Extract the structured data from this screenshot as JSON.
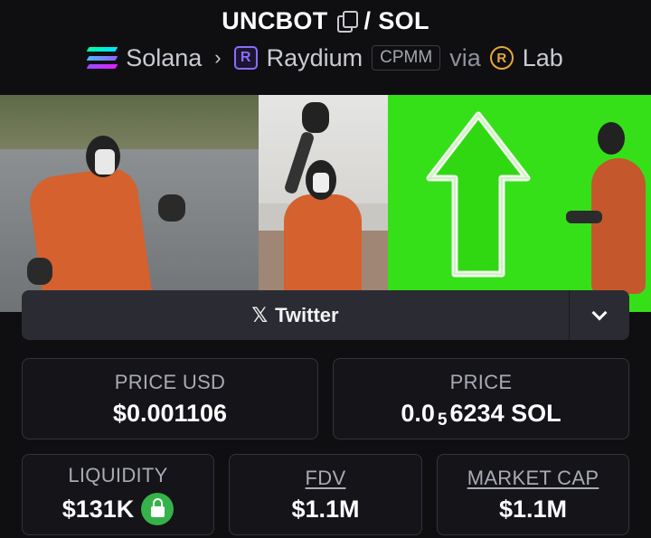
{
  "header": {
    "token_symbol": "UNCBOT",
    "separator": "/",
    "quote_symbol": "SOL"
  },
  "breadcrumb": {
    "chain": "Solana",
    "dex": "Raydium",
    "pool_type": "CPMM",
    "via": "via",
    "launchpad": "Lab",
    "dex_icon_letter": "R",
    "launchpad_icon_letter": "R",
    "chevron": "›"
  },
  "icons": {
    "chain": "solana-icon",
    "dex": "raydium-icon",
    "launchpad": "lab-icon",
    "copy": "copy-icon",
    "twitter": "x-icon",
    "dropdown": "chevron-down-icon",
    "lock": "lock-icon"
  },
  "links": {
    "twitter_label": "Twitter",
    "x_glyph": "𝕏"
  },
  "stats": {
    "price_usd": {
      "label": "PRICE USD",
      "value": "$0.001106"
    },
    "price": {
      "label": "PRICE",
      "prefix": "0.0",
      "zeros": "5",
      "suffix": "6234 SOL"
    },
    "liquidity": {
      "label": "LIQUIDITY",
      "value": "$131K"
    },
    "fdv": {
      "label": "FDV",
      "value": "$1.1M"
    },
    "market_cap": {
      "label": "MARKET CAP",
      "value": "$1.1M"
    }
  },
  "colors": {
    "background": "#0f0f12",
    "card_border": "#33343c",
    "lock_green": "#36b24a",
    "banner_green": "#35e018",
    "jumpsuit_orange": "#d4612e"
  }
}
